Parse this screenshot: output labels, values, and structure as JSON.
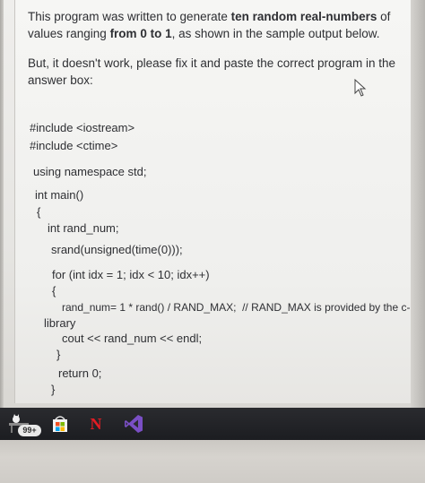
{
  "question": {
    "p1_a": "This program was written to generate ",
    "p1_b": "ten random real-numbers",
    "p1_c": " of values ranging ",
    "p1_d": "from 0 to 1",
    "p1_e": ", as shown in the sample output below.",
    "p2": "But, it doesn't work, please fix it and paste the correct program in the answer box:"
  },
  "code_lines": [
    "#include <iostream>",
    "#include <ctime>",
    "using namespace std;",
    "int main()",
    "{",
    "int rand_num;",
    "srand(unsigned(time(0)));",
    "for (int idx = 1; idx < 10; idx++)",
    "{",
    "rand_num= 1 * rand() / RAND_MAX;  // RAND_MAX is provided by the c-",
    "library",
    "cout << rand_num << endl;",
    "}",
    "return 0;",
    "}"
  ],
  "taskbar": {
    "badge": "99+",
    "icons": [
      "cat-desk-icon",
      "store-icon",
      "netflix-icon",
      "visual-studio-icon"
    ],
    "netflix_letter": "N"
  },
  "colors": {
    "text": "#2e2f33",
    "taskbar": "#1f2024",
    "netflix": "#e41c23",
    "vs": "#7a4fc5"
  }
}
